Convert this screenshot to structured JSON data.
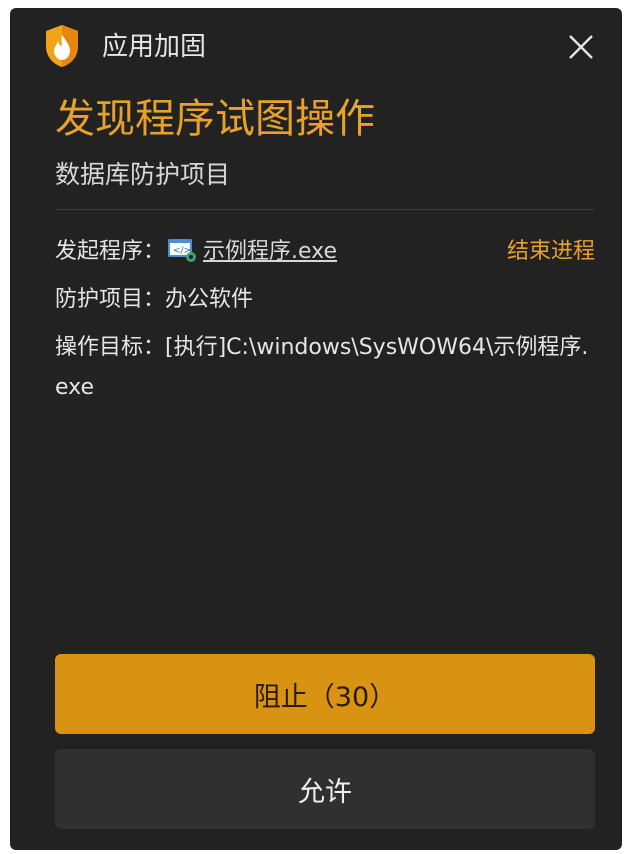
{
  "window": {
    "app_name": "应用加固",
    "app_icon": "shield-flame-icon",
    "close_icon": "close-icon"
  },
  "alert": {
    "headline": "发现程序试图操作",
    "subhead": "数据库防护项目"
  },
  "details": {
    "initiator_label": "发起程序：",
    "initiator_icon": "program-icon",
    "initiator_value": "示例程序.exe",
    "end_process_label": "结束进程",
    "protected_label": "防护项目：",
    "protected_value": "办公软件",
    "target_label": "操作目标：",
    "target_value": "[执行]C:\\windows\\SysWOW64\\示例程序.exe"
  },
  "actions": {
    "block_label": "阻止（30）",
    "allow_label": "允许"
  },
  "colors": {
    "background": "#222222",
    "accent": "#e8a12a",
    "block_button": "#d89313",
    "allow_button": "#303030"
  }
}
